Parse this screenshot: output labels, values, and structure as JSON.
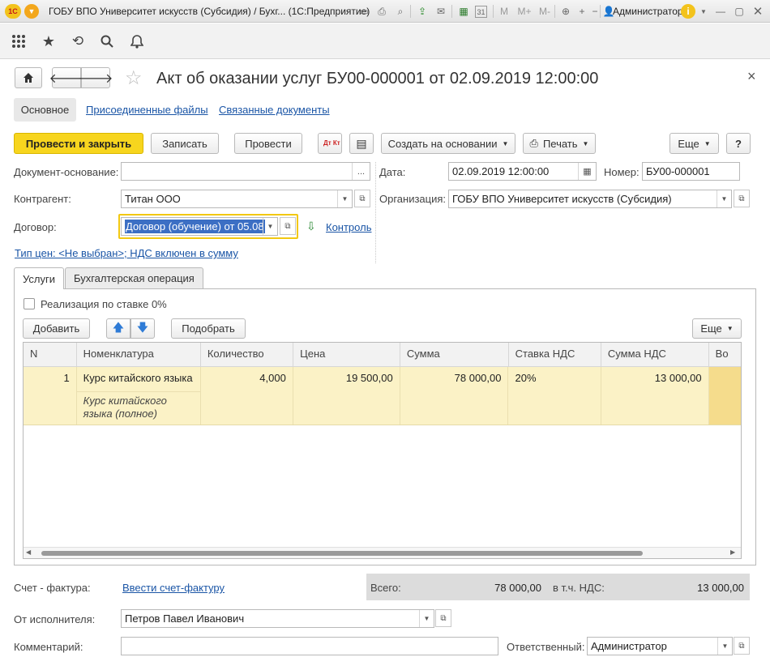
{
  "window": {
    "title": "ГОБУ ВПО Университет искусств (Субсидия) / Бухг...  (1С:Предприятие)",
    "user": "Администратор",
    "logo": "1С",
    "icons": [
      "doc-icon",
      "print-icon",
      "preview-icon",
      "save-icon",
      "calendar-icon",
      "calc-icon",
      "m-icon",
      "mplus-icon",
      "mminus-icon",
      "zoom-icon",
      "plus-icon",
      "minus-icon",
      "restore-icon",
      "info-icon"
    ],
    "toolbar_labels": {
      "m": "M",
      "mplus": "M+",
      "mminus": "M-",
      "cal_day": "31"
    }
  },
  "nav_icons": [
    "grid-menu-icon",
    "star-icon",
    "history-icon",
    "search-icon",
    "bell-icon"
  ],
  "doc": {
    "title": "Акт об оказании услуг БУ00-000001 от 02.09.2019 12:00:00",
    "close_glyph": "×"
  },
  "subtabs": [
    "Основное",
    "Присоединенные файлы",
    "Связанные документы"
  ],
  "buttons": {
    "post_close": "Провести и закрыть",
    "save": "Записать",
    "post": "Провести",
    "dt_kt": "Дт Кт",
    "create_based": "Создать на основании",
    "print": "Печать",
    "more": "Еще",
    "help": "?"
  },
  "form": {
    "base_doc_label": "Документ-основание:",
    "base_doc_value": "",
    "base_doc_btn": "...",
    "date_label": "Дата:",
    "date_value": "02.09.2019 12:00:00",
    "number_label": "Номер:",
    "number_value": "БУ00-000001",
    "counterparty_label": "Контрагент:",
    "counterparty_value": "Титан ООО",
    "org_label": "Организация:",
    "org_value": "ГОБУ ВПО Университет искусств (Субсидия)",
    "contract_label": "Договор:",
    "contract_value": "Договор (обучение) от 05.08",
    "control_link": "Контроль",
    "price_type_link": "Тип цен: <Не выбран>; НДС включен в сумму"
  },
  "tabs": [
    "Услуги",
    "Бухгалтерская операция"
  ],
  "services": {
    "zero_rate_label": "Реализация по ставке 0%",
    "add_btn": "Добавить",
    "pick_btn": "Подобрать",
    "more_btn": "Еще",
    "columns": [
      "N",
      "Номенклатура",
      "Количество",
      "Цена",
      "Сумма",
      "Ставка НДС",
      "Сумма НДС",
      "Во"
    ],
    "rows": [
      {
        "n": "1",
        "item": "Курс китайского языка",
        "item_full": "Курс китайского языка (полное)",
        "qty": "4,000",
        "price": "19 500,00",
        "sum": "78 000,00",
        "vat_rate": "20%",
        "vat_sum": "13 000,00"
      }
    ]
  },
  "footer": {
    "invoice_label": "Счет - фактура:",
    "invoice_link": "Ввести счет-фактуру",
    "total_label": "Всего:",
    "total_value": "78 000,00",
    "vat_label": "в т.ч. НДС:",
    "vat_value": "13 000,00",
    "executor_label": "От исполнителя:",
    "executor_value": "Петров Павел Иванович",
    "comment_label": "Комментарий:",
    "comment_value": "",
    "responsible_label": "Ответственный:",
    "responsible_value": "Администратор"
  }
}
